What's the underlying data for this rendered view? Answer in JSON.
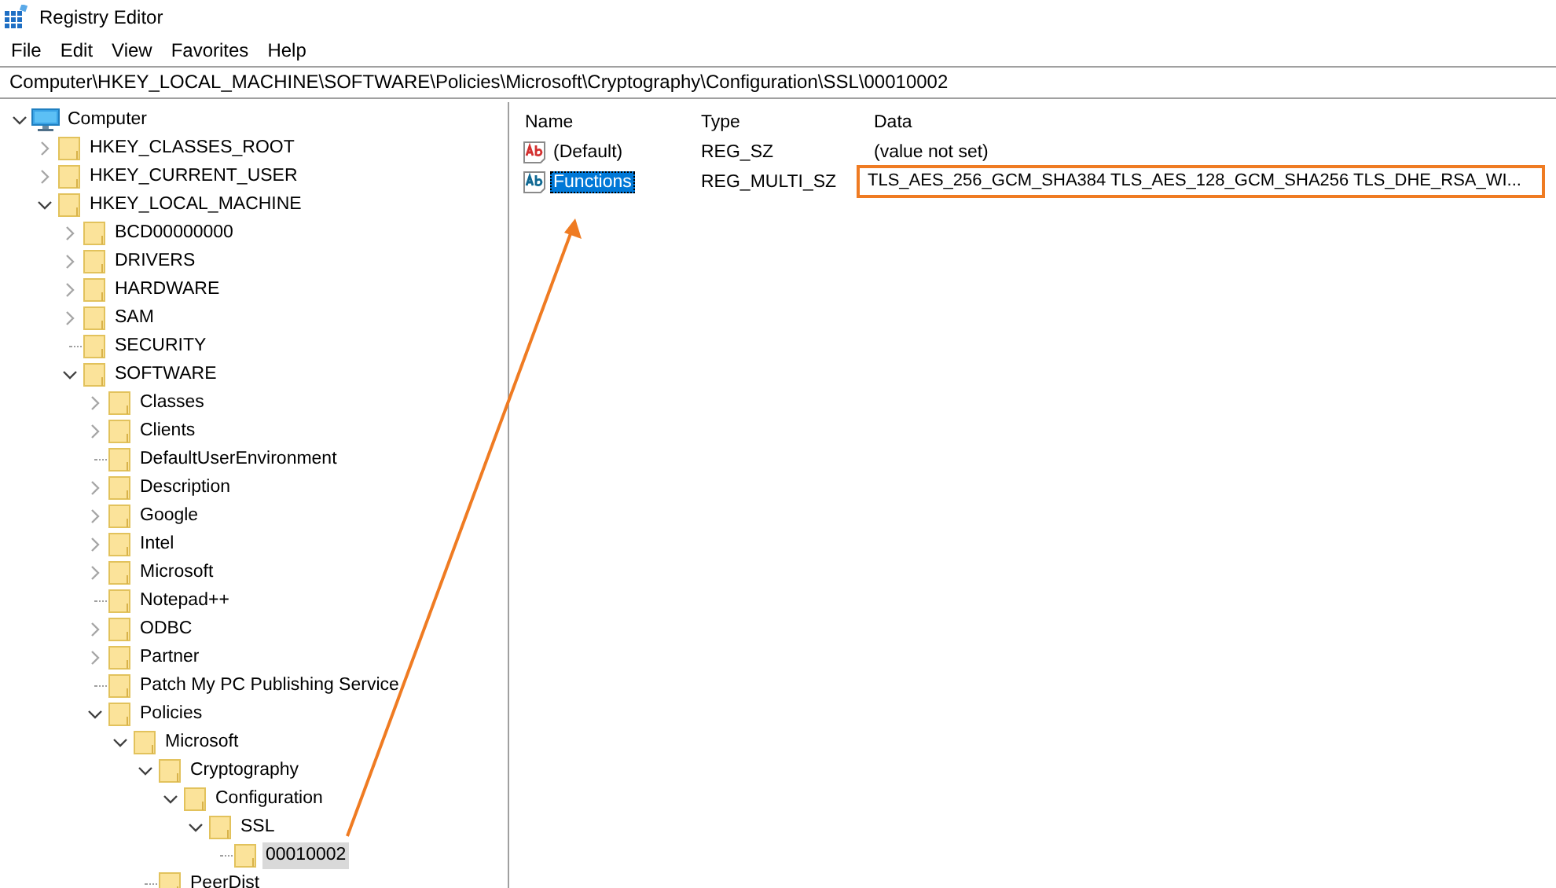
{
  "window": {
    "title": "Registry Editor"
  },
  "menu": [
    "File",
    "Edit",
    "View",
    "Favorites",
    "Help"
  ],
  "address": "Computer\\HKEY_LOCAL_MACHINE\\SOFTWARE\\Policies\\Microsoft\\Cryptography\\Configuration\\SSL\\00010002",
  "tree": [
    {
      "label": "Computer",
      "kind": "computer",
      "expanded": true,
      "selected": false,
      "children": [
        {
          "label": "HKEY_CLASSES_ROOT",
          "kind": "folder",
          "expanded": false,
          "selected": false
        },
        {
          "label": "HKEY_CURRENT_USER",
          "kind": "folder",
          "expanded": false,
          "selected": false
        },
        {
          "label": "HKEY_LOCAL_MACHINE",
          "kind": "folder",
          "expanded": true,
          "selected": false,
          "children": [
            {
              "label": "BCD00000000",
              "kind": "folder",
              "expanded": false,
              "selected": false
            },
            {
              "label": "DRIVERS",
              "kind": "folder",
              "expanded": false,
              "selected": false
            },
            {
              "label": "HARDWARE",
              "kind": "folder",
              "expanded": false,
              "selected": false
            },
            {
              "label": "SAM",
              "kind": "folder",
              "expanded": false,
              "selected": false
            },
            {
              "label": "SECURITY",
              "kind": "leaf",
              "selected": false
            },
            {
              "label": "SOFTWARE",
              "kind": "folder",
              "expanded": true,
              "selected": false,
              "children": [
                {
                  "label": "Classes",
                  "kind": "folder",
                  "expanded": false,
                  "selected": false
                },
                {
                  "label": "Clients",
                  "kind": "folder",
                  "expanded": false,
                  "selected": false
                },
                {
                  "label": "DefaultUserEnvironment",
                  "kind": "leaf",
                  "selected": false
                },
                {
                  "label": "Description",
                  "kind": "folder",
                  "expanded": false,
                  "selected": false
                },
                {
                  "label": "Google",
                  "kind": "folder",
                  "expanded": false,
                  "selected": false
                },
                {
                  "label": "Intel",
                  "kind": "folder",
                  "expanded": false,
                  "selected": false
                },
                {
                  "label": "Microsoft",
                  "kind": "folder",
                  "expanded": false,
                  "selected": false
                },
                {
                  "label": "Notepad++",
                  "kind": "leaf",
                  "selected": false
                },
                {
                  "label": "ODBC",
                  "kind": "folder",
                  "expanded": false,
                  "selected": false
                },
                {
                  "label": "Partner",
                  "kind": "folder",
                  "expanded": false,
                  "selected": false
                },
                {
                  "label": "Patch My PC Publishing Service",
                  "kind": "leaf",
                  "selected": false
                },
                {
                  "label": "Policies",
                  "kind": "folder",
                  "expanded": true,
                  "selected": false,
                  "children": [
                    {
                      "label": "Microsoft",
                      "kind": "folder",
                      "expanded": true,
                      "selected": false,
                      "children": [
                        {
                          "label": "Cryptography",
                          "kind": "folder",
                          "expanded": true,
                          "selected": false,
                          "children": [
                            {
                              "label": "Configuration",
                              "kind": "folder",
                              "expanded": true,
                              "selected": false,
                              "children": [
                                {
                                  "label": "SSL",
                                  "kind": "folder",
                                  "expanded": true,
                                  "selected": false,
                                  "children": [
                                    {
                                      "label": "00010002",
                                      "kind": "leaf",
                                      "selected": true
                                    }
                                  ]
                                }
                              ]
                            }
                          ]
                        },
                        {
                          "label": "PeerDist",
                          "kind": "leaf",
                          "selected": false
                        }
                      ]
                    }
                  ]
                }
              ]
            }
          ]
        }
      ]
    }
  ],
  "values": {
    "columns": [
      "Name",
      "Type",
      "Data"
    ],
    "rows": [
      {
        "name": "(Default)",
        "type": "REG_SZ",
        "data": "(value not set)",
        "selected": false,
        "highlighted": false
      },
      {
        "name": "Functions",
        "type": "REG_MULTI_SZ",
        "data": "TLS_AES_256_GCM_SHA384 TLS_AES_128_GCM_SHA256 TLS_DHE_RSA_WI...",
        "selected": true,
        "highlighted": true
      }
    ]
  }
}
